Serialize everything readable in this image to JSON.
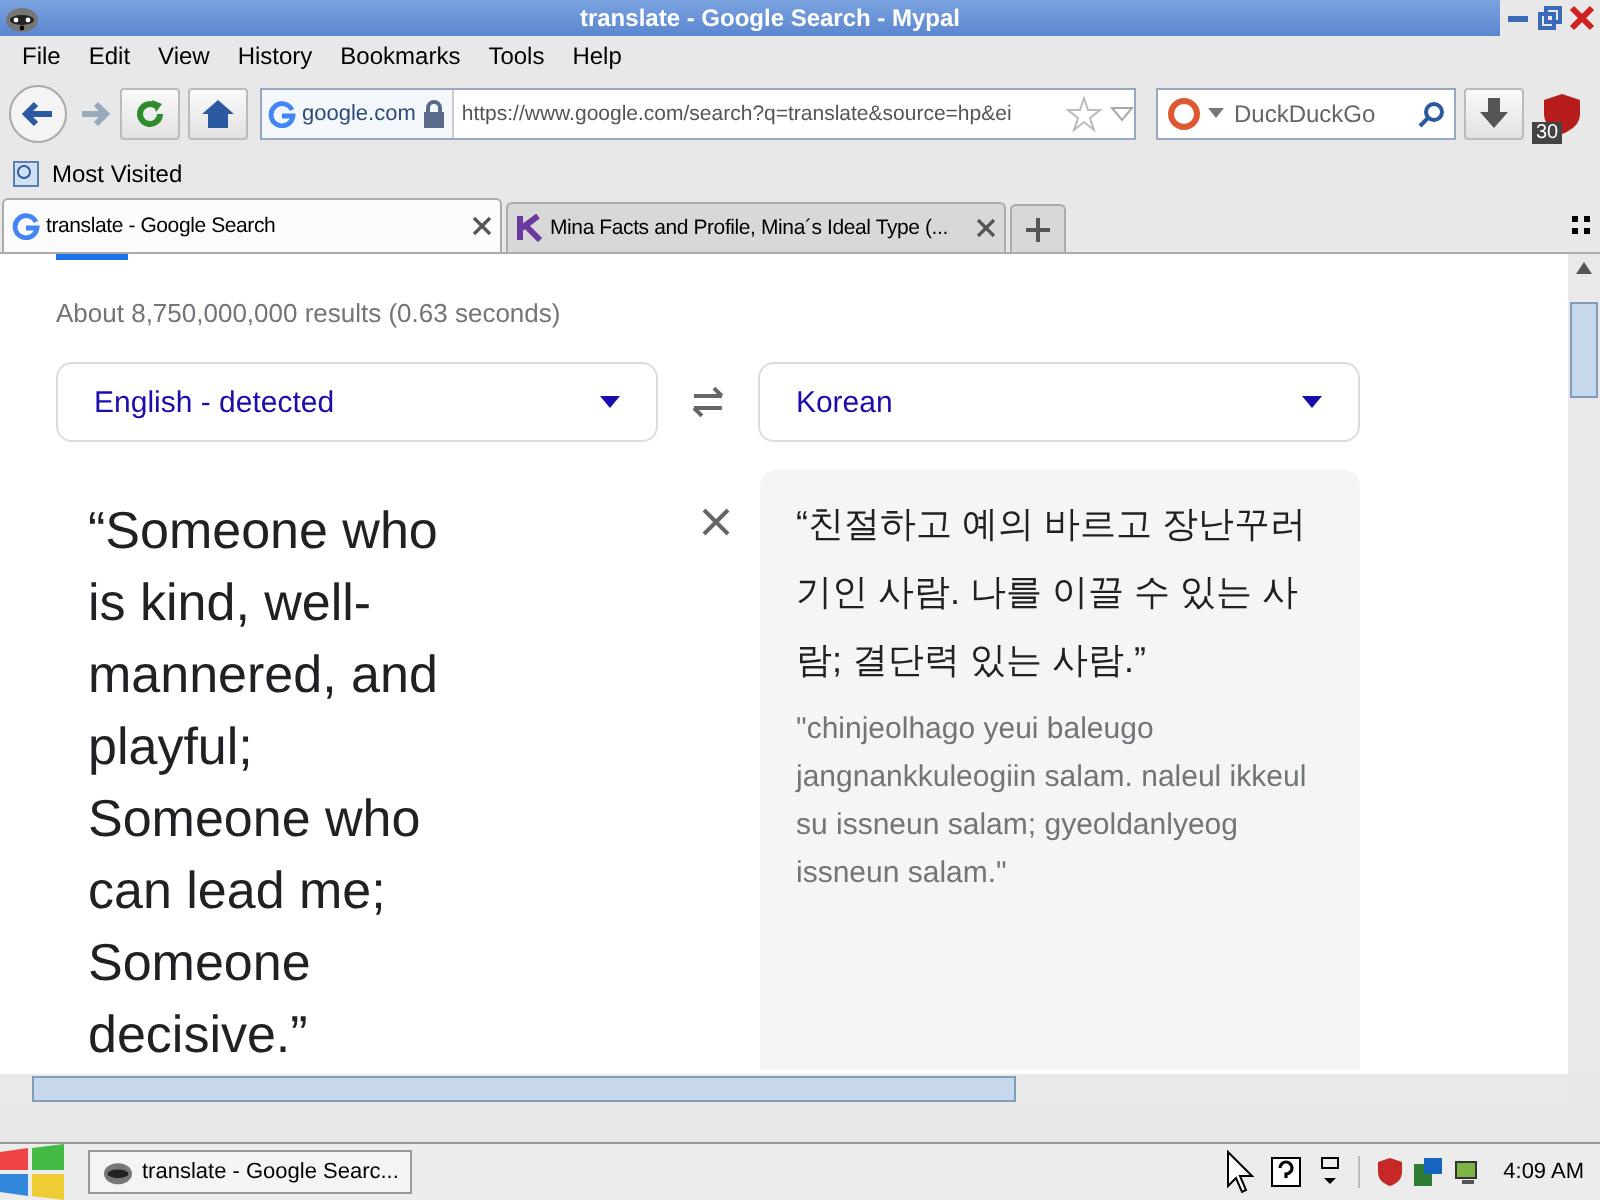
{
  "window": {
    "title": "translate - Google Search - Mypal"
  },
  "menu": [
    "File",
    "Edit",
    "View",
    "History",
    "Bookmarks",
    "Tools",
    "Help"
  ],
  "navigation": {
    "site_identity": "google.com",
    "url": "https://www.google.com/search?q=translate&source=hp&ei",
    "search_placeholder": "DuckDuckGo",
    "addon_badge": "30"
  },
  "bookmarks": [
    "Most Visited"
  ],
  "tabs": [
    {
      "label": "translate - Google Search",
      "selected": true
    },
    {
      "label": "Mina Facts and Profile, Mina´s Ideal Type (...",
      "selected": false
    }
  ],
  "page": {
    "results_stats": "About 8,750,000,000 results (0.63 seconds)",
    "source_language": "English - detected",
    "target_language": "Korean",
    "source_text": "“Someone who is kind, well-mannered, and playful; Someone who can lead me; Someone decisive.”",
    "translation": "“친절하고 예의 바르고 장난꾸러기인 사람. 나를 이끌 수 있는 사람; 결단력 있는 사람.”",
    "romanization": "\"chinjeolhago yeui baleugo jangnankkuleogiin salam. naleul ikkeul su issneun salam; gyeoldanlyeog issneun salam.\""
  },
  "taskbar": {
    "task": "translate - Google Searc...",
    "clock": "4:09 AM"
  }
}
